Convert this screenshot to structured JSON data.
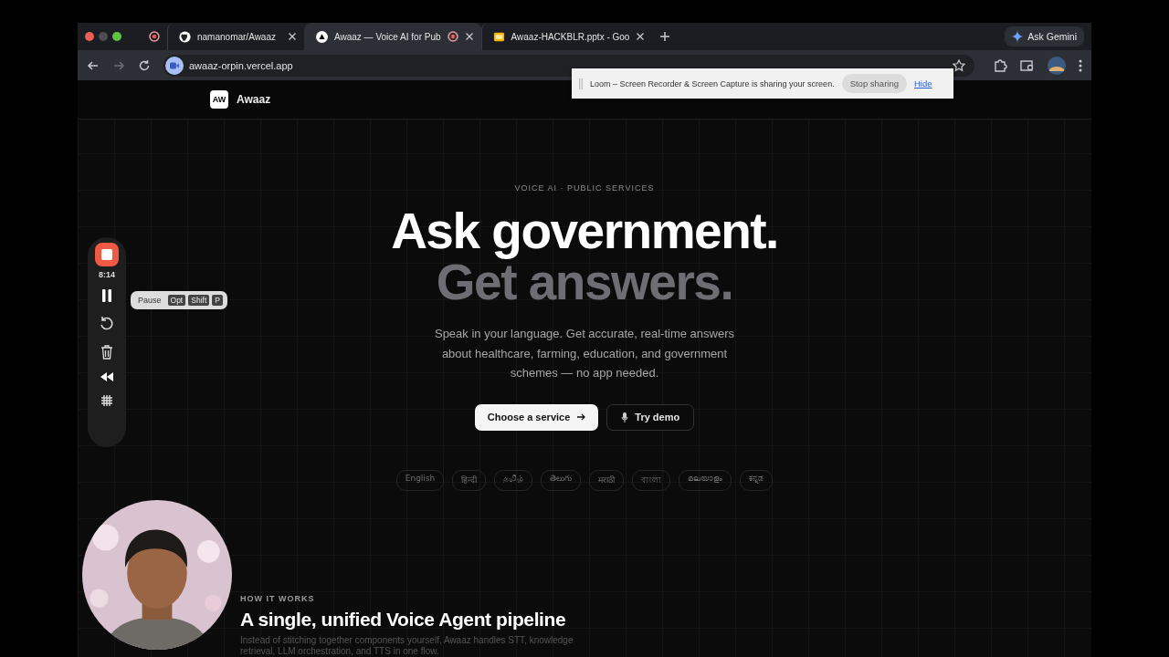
{
  "browser": {
    "tabs": [
      {
        "kind": "pinned",
        "selected": false
      },
      {
        "kind": "github",
        "title": "namanomar/Awaaz",
        "selected": false,
        "recording": false
      },
      {
        "kind": "site",
        "title": "Awaaz — Voice AI for Pub",
        "selected": true,
        "recording": true
      },
      {
        "kind": "slides",
        "title": "Awaaz-HACKBLR.pptx - Goo",
        "selected": false,
        "recording": false
      }
    ],
    "gemini_button": "Ask Gemini",
    "url": "awaaz-orpin.vercel.app"
  },
  "sharing_banner": {
    "message": "Loom – Screen Recorder & Screen Capture is sharing your screen.",
    "stop_button": "Stop sharing",
    "hide_link": "Hide"
  },
  "site": {
    "logo": "AW",
    "brand": "Awaaz",
    "eyebrow": "VOICE AI · PUBLIC SERVICES",
    "headline": "Ask government.",
    "headline_muted": "Get answers.",
    "intro": "Speak in your language. Get accurate, real-time answers about healthcare, farming, education, and government schemes — no app needed.",
    "primary_button": "Choose a service",
    "secondary_button": "Try demo",
    "languages": [
      "English",
      "हिन्दी",
      "தமிழ்",
      "తెలుగు",
      "मराठी",
      "বাংলা",
      "മലയാളം",
      "ಕನ್ನಡ"
    ],
    "section_eyebrow": "HOW IT WORKS",
    "section_title": "A single, unified Voice Agent pipeline",
    "section_text": "Instead of stitching together components yourself, Awaaz handles STT, knowledge retrieval, LLM orchestration, and TTS in one flow."
  },
  "recorder": {
    "time": "8:14",
    "tooltip": {
      "label": "Pause",
      "keys": [
        "Opt",
        "Shift",
        "P"
      ]
    }
  }
}
